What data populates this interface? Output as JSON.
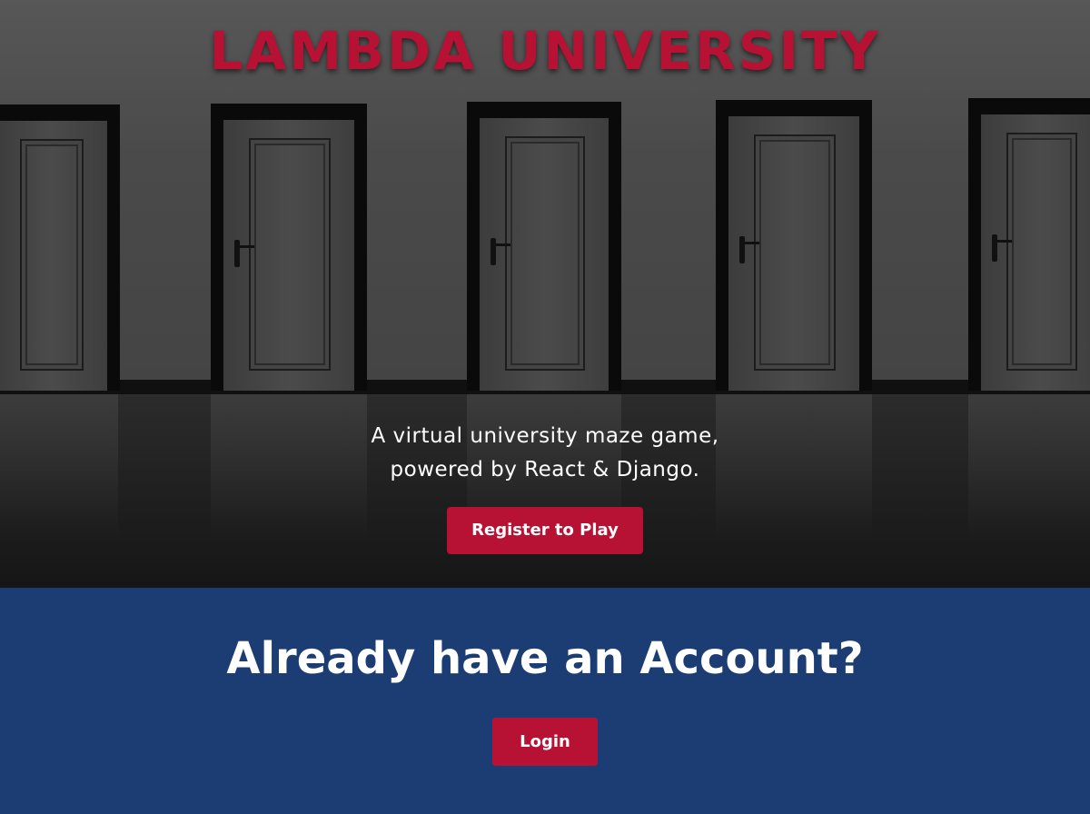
{
  "hero": {
    "title": "LAMBDA UNIVERSITY",
    "tagline_line1": "A virtual university maze game,",
    "tagline_line2": "powered by React & Django.",
    "register_label": "Register to Play"
  },
  "account": {
    "heading": "Already have an Account?",
    "login_label": "Login"
  },
  "colors": {
    "brand_red": "#b71234",
    "navy": "#1c3c74",
    "text_white": "#ffffff"
  },
  "icons": {
    "background": "doors-hallway-image"
  }
}
